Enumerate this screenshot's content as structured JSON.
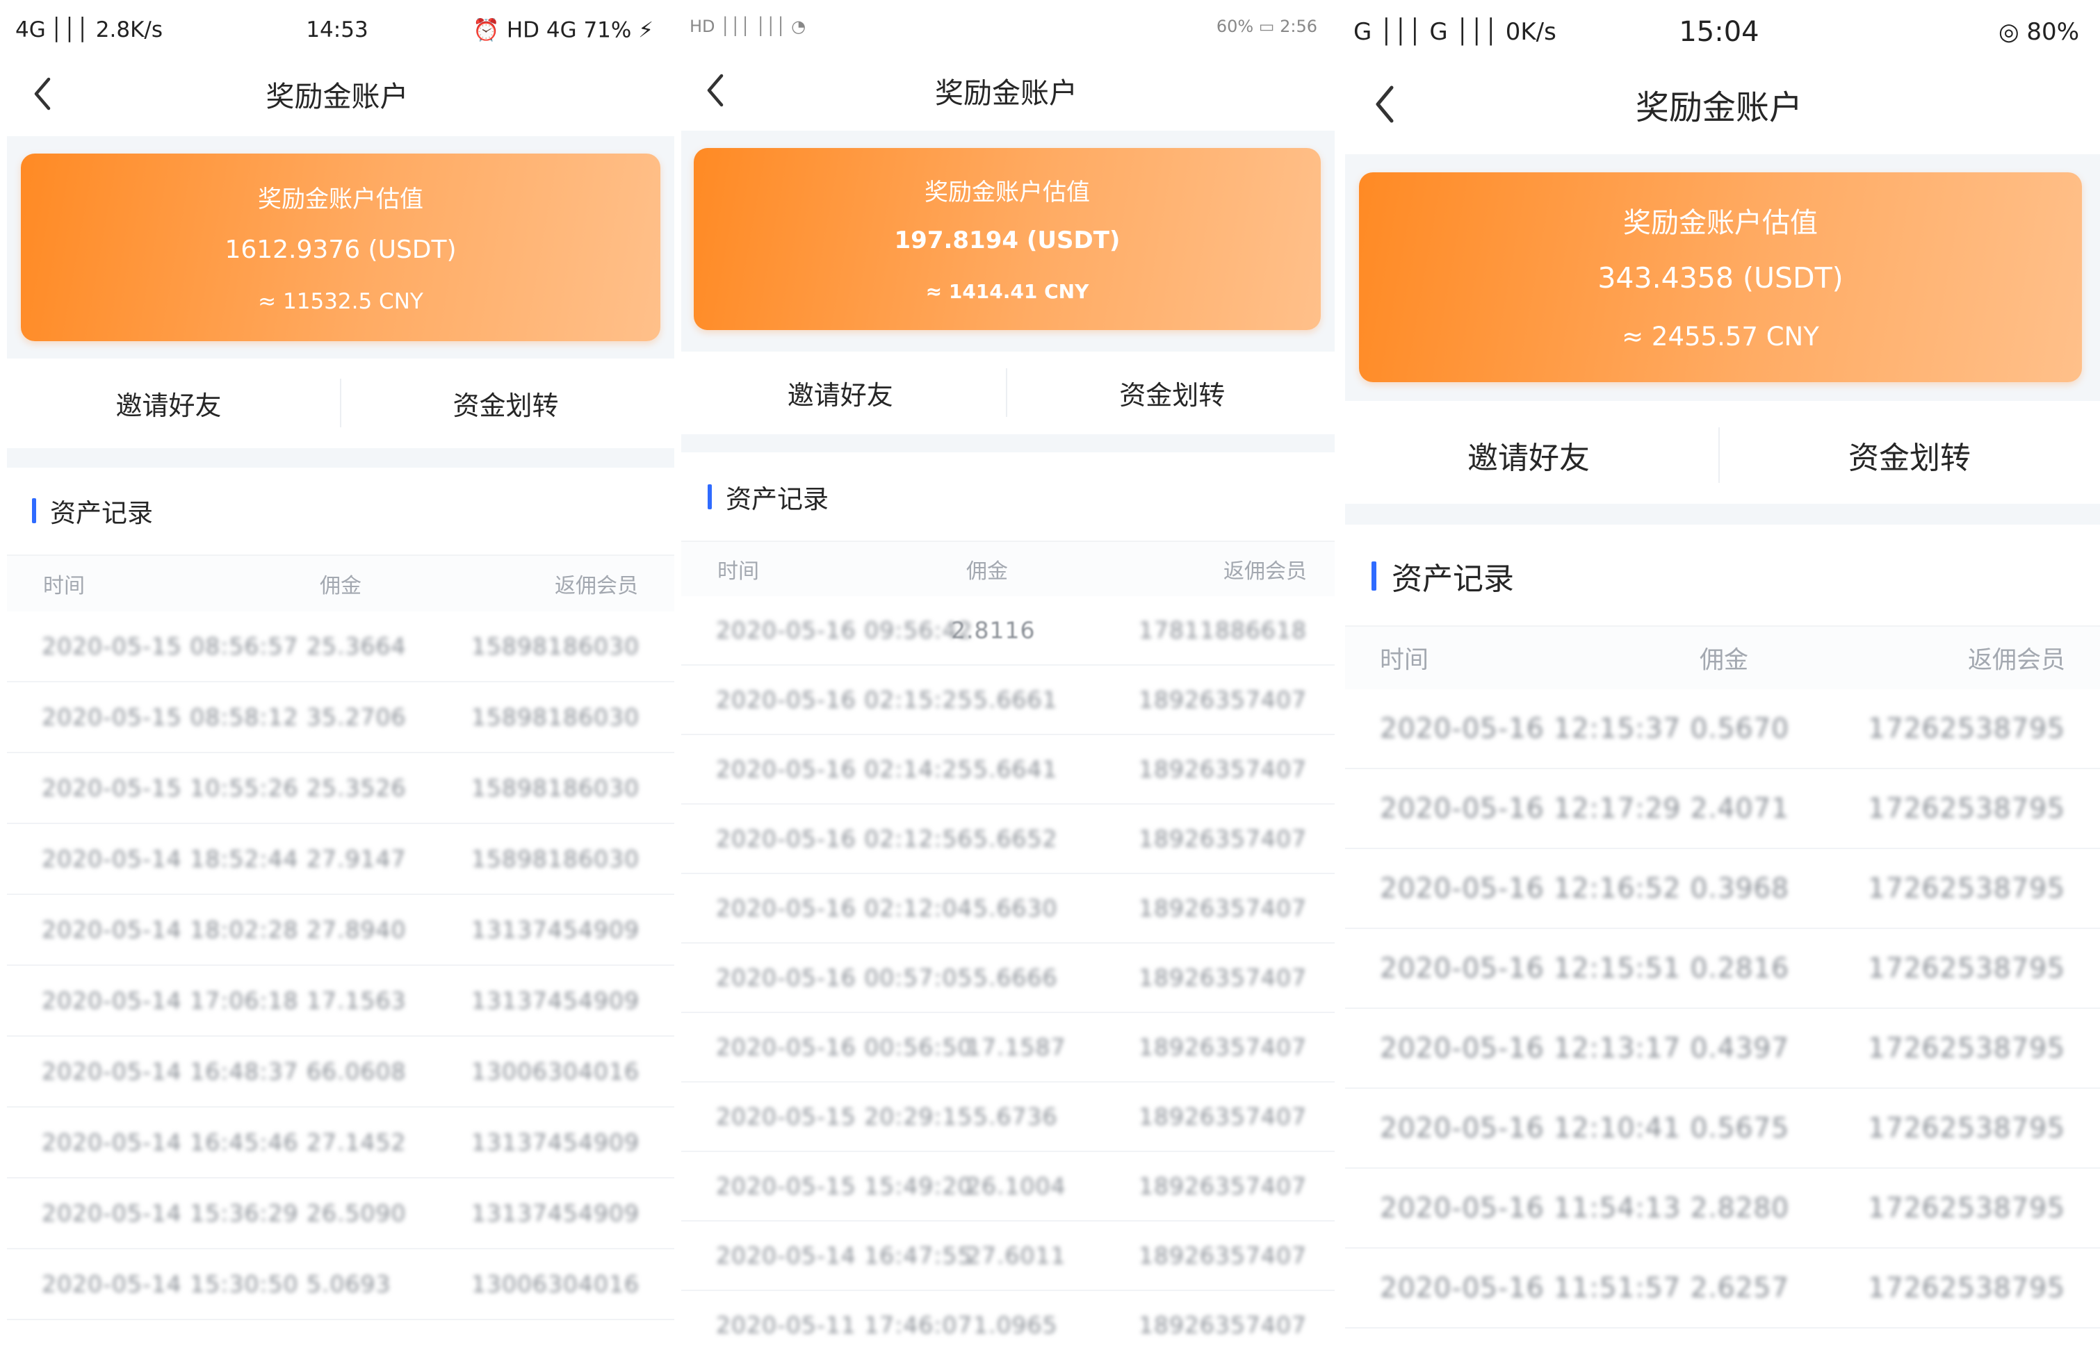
{
  "colors": {
    "accent_blue": "#2f6bff",
    "card_gradient_start": "#ff8a24",
    "card_gradient_end": "#ffc08a",
    "band_bg": "#f3f6f9"
  },
  "panels": [
    {
      "status": {
        "left": "4G │││ 2.8K/s",
        "center": "14:53",
        "right": "⏰ HD 4G 71% ⚡"
      },
      "nav": {
        "title": "奖励金账户",
        "back_icon": "chevron-left-icon"
      },
      "card": {
        "title": "奖励金账户估值",
        "value": "1612.9376 (USDT)",
        "cny": "≈ 11532.5 CNY"
      },
      "actions": {
        "invite": "邀请好友",
        "transfer": "资金划转"
      },
      "section_title": "资产记录",
      "table": {
        "headers": [
          "时间",
          "佣金",
          "返佣会员"
        ],
        "rows": [
          [
            "2020-05-15 08:56:57 25.3664",
            "",
            "15898186030"
          ],
          [
            "2020-05-15 08:58:12 35.2706",
            "",
            "15898186030"
          ],
          [
            "2020-05-15 10:55:26 25.3526",
            "",
            "15898186030"
          ],
          [
            "2020-05-14 18:52:44 27.9147",
            "",
            "15898186030"
          ],
          [
            "2020-05-14 18:02:28 27.8940",
            "",
            "13137454909"
          ],
          [
            "2020-05-14 17:06:18 17.1563",
            "",
            "13137454909"
          ],
          [
            "2020-05-14 16:48:37 66.0608",
            "",
            "13006304016"
          ],
          [
            "2020-05-14 16:45:46 27.1452",
            "",
            "13137454909"
          ],
          [
            "2020-05-14 15:36:29 26.5090",
            "",
            "13137454909"
          ],
          [
            "2020-05-14 15:30:50 5.0693",
            "",
            "13006304016"
          ]
        ]
      }
    },
    {
      "status": {
        "left": "HD │││ │││ ◔",
        "center": "",
        "right": "60% ▭ 2:56"
      },
      "nav": {
        "title": "奖励金账户",
        "back_icon": "chevron-left-icon"
      },
      "card": {
        "title": "奖励金账户估值",
        "value": "197.8194 (USDT)",
        "cny": "≈ 1414.41 CNY"
      },
      "actions": {
        "invite": "邀请好友",
        "transfer": "资金划转"
      },
      "section_title": "资产记录",
      "table": {
        "headers": [
          "时间",
          "佣金",
          "返佣会员"
        ],
        "rows": [
          [
            "2020-05-16 09:56:42",
            "2.8116",
            "17811886618"
          ],
          [
            "2020-05-16 02:15:25",
            "5.6661",
            "18926357407"
          ],
          [
            "2020-05-16 02:14:25",
            "5.6641",
            "18926357407"
          ],
          [
            "2020-05-16 02:12:56",
            "5.6652",
            "18926357407"
          ],
          [
            "2020-05-16 02:12:04",
            "5.6630",
            "18926357407"
          ],
          [
            "2020-05-16 00:57:05",
            "5.6666",
            "18926357407"
          ],
          [
            "2020-05-16 00:56:50",
            "17.1587",
            "18926357407"
          ],
          [
            "2020-05-15 20:29:15",
            "5.6736",
            "18926357407"
          ],
          [
            "2020-05-15 15:49:20",
            "26.1004",
            "18926357407"
          ],
          [
            "2020-05-14 16:47:55",
            "27.6011",
            "18926357407"
          ],
          [
            "2020-05-11 17:46:07",
            "1.0965",
            "18926357407"
          ]
        ]
      }
    },
    {
      "status": {
        "left": "G │││ G │││ 0K/s",
        "center": "15:04",
        "right": "◎ 80%"
      },
      "nav": {
        "title": "奖励金账户",
        "back_icon": "chevron-left-icon"
      },
      "card": {
        "title": "奖励金账户估值",
        "value": "343.4358 (USDT)",
        "cny": "≈ 2455.57 CNY"
      },
      "actions": {
        "invite": "邀请好友",
        "transfer": "资金划转"
      },
      "section_title": "资产记录",
      "table": {
        "headers": [
          "时间",
          "佣金",
          "返佣会员"
        ],
        "rows": [
          [
            "2020-05-16 12:15:37 0.5670",
            "",
            "17262538795"
          ],
          [
            "2020-05-16 12:17:29 2.4071",
            "",
            "17262538795"
          ],
          [
            "2020-05-16 12:16:52 0.3968",
            "",
            "17262538795"
          ],
          [
            "2020-05-16 12:15:51 0.2816",
            "",
            "17262538795"
          ],
          [
            "2020-05-16 12:13:17 0.4397",
            "",
            "17262538795"
          ],
          [
            "2020-05-16 12:10:41 0.5675",
            "",
            "17262538795"
          ],
          [
            "2020-05-16 11:54:13 2.8280",
            "",
            "17262538795"
          ],
          [
            "2020-05-16 11:51:57 2.6257",
            "",
            "17262538795"
          ]
        ]
      }
    }
  ]
}
